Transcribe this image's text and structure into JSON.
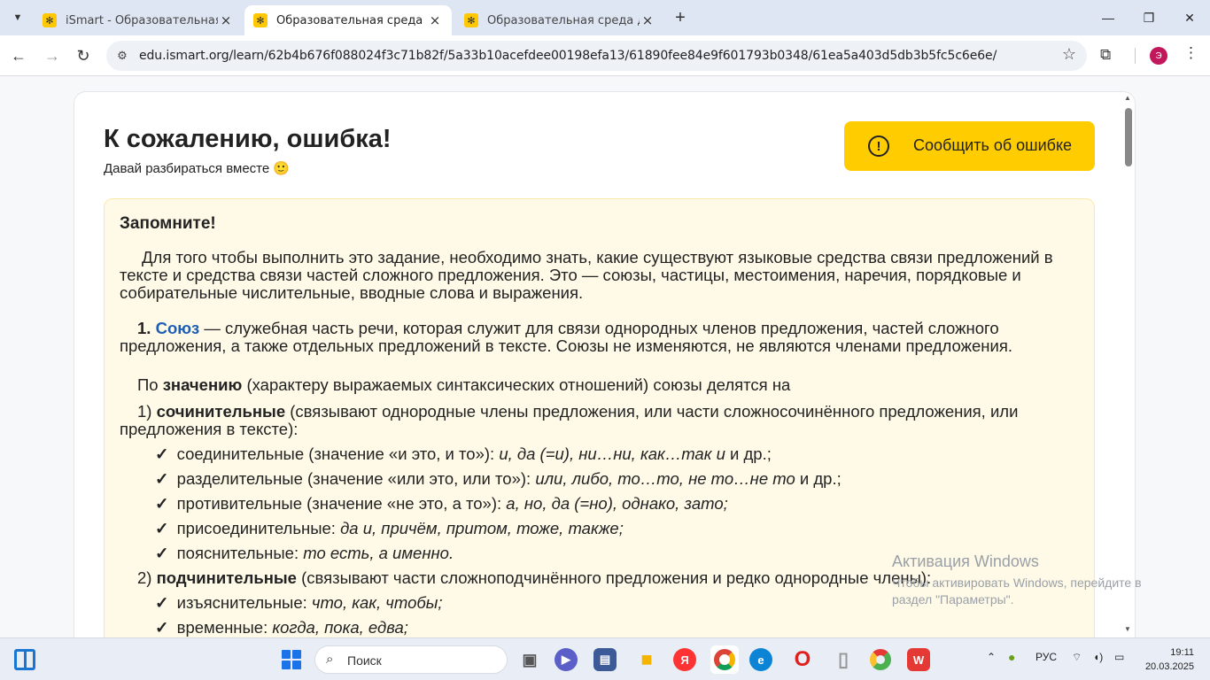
{
  "browser": {
    "tabs": [
      {
        "label": "iSmart - Образовательная пла",
        "active": false
      },
      {
        "label": "Образовательная среда для са",
        "active": true
      },
      {
        "label": "Образовательная среда для са",
        "active": false
      }
    ],
    "url": "edu.ismart.org/learn/62b4b676f088024f3c71b82f/5a33b10acefdee00198efa13/61890fee84e9f601793b0348/61ea5a403d5db3b5fc5c6e6e/",
    "profile_initial": "Э"
  },
  "page": {
    "title": "К сожалению, ошибка!",
    "subtitle": "Давай разбираться вместе 🙂",
    "report_button": "Сообщить об ошибке",
    "notice": {
      "heading": "Запомните!",
      "intro": "Для того чтобы выполнить это задание, необходимо знать, какие существуют языковые средства связи предложений в тексте и средства связи частей сложного предложения. Это — союзы, частицы, местоимения, наречия, порядковые и собирательные числительные, вводные слова и выражения.",
      "item1_num": "1.",
      "item1_term": "Союз",
      "item1_text": "— служебная часть речи, которая служит для связи однородных членов предложения, частей сложного предложения, а также отдельных предложений в тексте. Союзы не изменяются, не являются членами предложения.",
      "meaning_pre": "По",
      "meaning_bold": "значению",
      "meaning_post": "(характеру выражаемых синтаксических отношений) союзы делятся на",
      "coord_num": "1)",
      "coord_bold": "сочинительные",
      "coord_text": "(связывают однородные члены предложения, или части сложносочинённого предложения, или предложения в тексте):",
      "coord_list": [
        {
          "label": "соединительные (значение «и это, и то»):",
          "examples": "и, да (=и), ни…ни, как…так и",
          "tail": "и др.;"
        },
        {
          "label": "разделительные (значение «или это, или то»):",
          "examples": "или, либо, то…то, не то…не то",
          "tail": "и др.;"
        },
        {
          "label": "противительные (значение «не это, а то»):",
          "examples": "а, но, да (=но), однако, зато;",
          "tail": ""
        },
        {
          "label": "присоединительные:",
          "examples": "да и, причём, притом, тоже, также;",
          "tail": ""
        },
        {
          "label": "пояснительные:",
          "examples": "то есть, а именно.",
          "tail": ""
        }
      ],
      "sub_num": "2)",
      "sub_bold": "подчинительные",
      "sub_text": "(связывают части сложноподчинённого предложения и редко однородные члены):",
      "sub_list": [
        {
          "label": "изъяснительные:",
          "examples": "что, как, чтобы;",
          "tail": ""
        },
        {
          "label": "временные:",
          "examples": "когда, пока, едва;",
          "tail": ""
        }
      ],
      "check_mark": "✓"
    }
  },
  "watermark": {
    "title": "Активация Windows",
    "line1": "Чтобы активировать Windows, перейдите в",
    "line2": "раздел \"Параметры\"."
  },
  "taskbar": {
    "search_label": "Поиск",
    "lang": "РУС",
    "time": "19:11",
    "date": "20.03.2025"
  }
}
